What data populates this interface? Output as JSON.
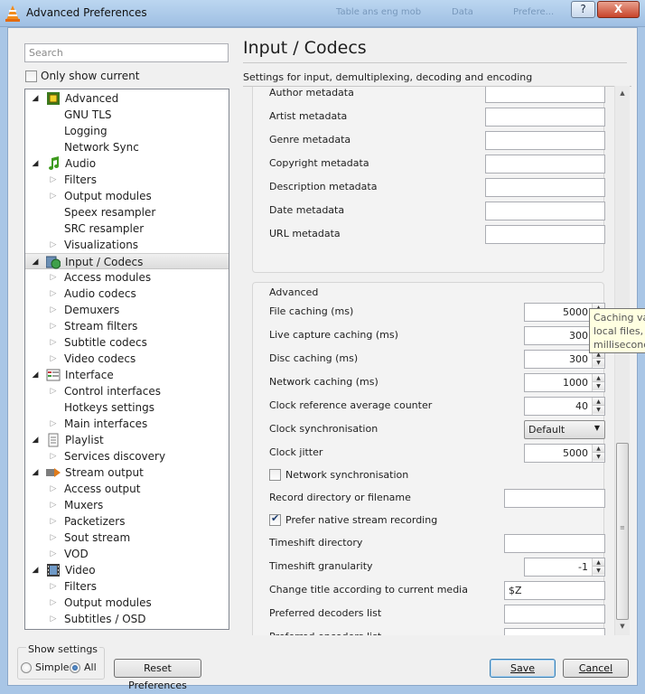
{
  "window": {
    "title": "Advanced Preferences",
    "help_label": "?",
    "close_label": "X",
    "background_tabs": [
      "Table ans eng mob",
      "Data",
      "Prefere..."
    ]
  },
  "left": {
    "search_placeholder": "Search",
    "only_show_current": "Only show current",
    "only_show_current_checked": false,
    "tree": [
      {
        "label": "Advanced",
        "level": 0,
        "icon": "chip-icon",
        "expanded": true
      },
      {
        "label": "GNU TLS",
        "level": 1,
        "has_children": false
      },
      {
        "label": "Logging",
        "level": 1,
        "has_children": false
      },
      {
        "label": "Network Sync",
        "level": 1,
        "has_children": false
      },
      {
        "label": "Audio",
        "level": 0,
        "icon": "music-note-icon",
        "expanded": true
      },
      {
        "label": "Filters",
        "level": 1,
        "has_children": true
      },
      {
        "label": "Output modules",
        "level": 1,
        "has_children": true
      },
      {
        "label": "Speex resampler",
        "level": 1,
        "has_children": false
      },
      {
        "label": "SRC resampler",
        "level": 1,
        "has_children": false
      },
      {
        "label": "Visualizations",
        "level": 1,
        "has_children": true
      },
      {
        "label": "Input / Codecs",
        "level": 0,
        "icon": "input-codecs-icon",
        "expanded": true,
        "selected": true
      },
      {
        "label": "Access modules",
        "level": 1,
        "has_children": true
      },
      {
        "label": "Audio codecs",
        "level": 1,
        "has_children": true
      },
      {
        "label": "Demuxers",
        "level": 1,
        "has_children": true
      },
      {
        "label": "Stream filters",
        "level": 1,
        "has_children": true
      },
      {
        "label": "Subtitle codecs",
        "level": 1,
        "has_children": true
      },
      {
        "label": "Video codecs",
        "level": 1,
        "has_children": true
      },
      {
        "label": "Interface",
        "level": 0,
        "icon": "interface-icon",
        "expanded": true
      },
      {
        "label": "Control interfaces",
        "level": 1,
        "has_children": true
      },
      {
        "label": "Hotkeys settings",
        "level": 1,
        "has_children": false
      },
      {
        "label": "Main interfaces",
        "level": 1,
        "has_children": true
      },
      {
        "label": "Playlist",
        "level": 0,
        "icon": "playlist-icon",
        "expanded": true
      },
      {
        "label": "Services discovery",
        "level": 1,
        "has_children": true
      },
      {
        "label": "Stream output",
        "level": 0,
        "icon": "stream-output-icon",
        "expanded": true
      },
      {
        "label": "Access output",
        "level": 1,
        "has_children": true
      },
      {
        "label": "Muxers",
        "level": 1,
        "has_children": true
      },
      {
        "label": "Packetizers",
        "level": 1,
        "has_children": true
      },
      {
        "label": "Sout stream",
        "level": 1,
        "has_children": true
      },
      {
        "label": "VOD",
        "level": 1,
        "has_children": true
      },
      {
        "label": "Video",
        "level": 0,
        "icon": "film-icon",
        "expanded": true
      },
      {
        "label": "Filters",
        "level": 1,
        "has_children": true
      },
      {
        "label": "Output modules",
        "level": 1,
        "has_children": true
      },
      {
        "label": "Subtitles / OSD",
        "level": 1,
        "has_children": true
      }
    ]
  },
  "panel": {
    "title": "Input / Codecs",
    "subtitle": "Settings for input, demultiplexing, decoding and encoding",
    "metadata_rows": [
      {
        "label": "Author metadata",
        "value": ""
      },
      {
        "label": "Artist metadata",
        "value": ""
      },
      {
        "label": "Genre metadata",
        "value": ""
      },
      {
        "label": "Copyright metadata",
        "value": ""
      },
      {
        "label": "Description metadata",
        "value": ""
      },
      {
        "label": "Date metadata",
        "value": ""
      },
      {
        "label": "URL metadata",
        "value": ""
      }
    ],
    "advanced_title": "Advanced",
    "advanced_rows": [
      {
        "label": "File caching (ms)",
        "type": "spin",
        "value": "5000"
      },
      {
        "label": "Live capture caching (ms)",
        "type": "spin",
        "value": "300"
      },
      {
        "label": "Disc caching (ms)",
        "type": "spin",
        "value": "300"
      },
      {
        "label": "Network caching (ms)",
        "type": "spin",
        "value": "1000"
      },
      {
        "label": "Clock reference average counter",
        "type": "spin",
        "value": "40"
      },
      {
        "label": "Clock synchronisation",
        "type": "select",
        "value": "Default"
      },
      {
        "label": "Clock jitter",
        "type": "spin",
        "value": "5000"
      },
      {
        "label": "Network synchronisation",
        "type": "checkbox",
        "checked": false
      },
      {
        "label": "Record directory or filename",
        "type": "text",
        "value": ""
      },
      {
        "label": "Prefer native stream recording",
        "type": "checkbox",
        "checked": true
      },
      {
        "label": "Timeshift directory",
        "type": "text",
        "value": ""
      },
      {
        "label": "Timeshift granularity",
        "type": "spin",
        "value": "-1"
      },
      {
        "label": "Change title according to current media",
        "type": "text",
        "value": "$Z"
      },
      {
        "label": "Preferred decoders list",
        "type": "text",
        "value": ""
      },
      {
        "label": "Preferred encoders list",
        "type": "text",
        "value": ""
      }
    ],
    "tooltip_lines": [
      "Caching val",
      "local files, ir",
      "millisecond"
    ]
  },
  "bottom": {
    "show_settings": "Show settings",
    "simple": "Simple",
    "all": "All",
    "selected_mode": "All",
    "reset": "Reset Preferences",
    "save": "Save",
    "cancel": "Cancel"
  }
}
